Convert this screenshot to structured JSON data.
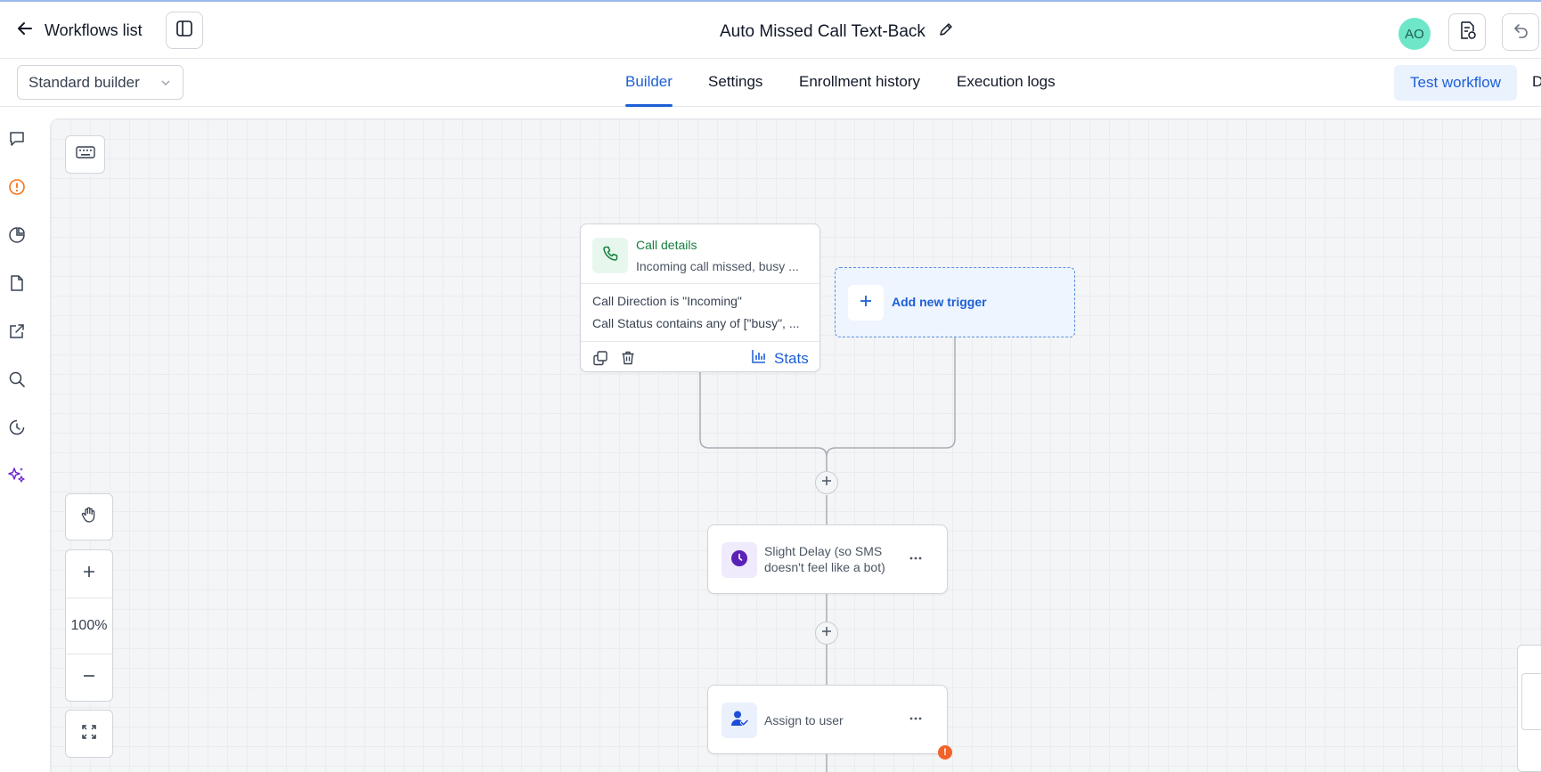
{
  "header": {
    "back_label": "Workflows list",
    "workflow_title": "Auto Missed Call Text-Back",
    "avatar_initials": "AO",
    "avatar_color": "#6ee7c8"
  },
  "subheader": {
    "builder_mode": "Standard builder",
    "tabs": [
      {
        "label": "Builder",
        "active": true
      },
      {
        "label": "Settings",
        "active": false
      },
      {
        "label": "Enrollment history",
        "active": false
      },
      {
        "label": "Execution logs",
        "active": false
      }
    ],
    "test_button": "Test workflow",
    "cut_off_tab": "D"
  },
  "left_rail": {
    "icons": [
      "chat-icon",
      "alert-circle-icon",
      "pie-chart-icon",
      "file-icon",
      "external-link-icon",
      "search-icon",
      "history-icon",
      "sparkle-icon"
    ]
  },
  "canvas": {
    "zoom_level": "100%",
    "trigger": {
      "title": "Call details",
      "subtitle": "Incoming call missed, busy ...",
      "conditions": [
        "Call Direction is \"Incoming\"",
        "Call Status contains any of [\"busy\", ..."
      ],
      "stats_label": "Stats"
    },
    "add_trigger_label": "Add new trigger",
    "actions": [
      {
        "label_line1": "Slight Delay (so SMS",
        "label_line2": "doesn't feel like a bot)",
        "icon": "clock-icon",
        "icon_color": "#5b21b6"
      },
      {
        "label_line1": "Assign to user",
        "icon": "user-assign-icon",
        "icon_color": "#1d4ed8",
        "has_warning": true,
        "warning_glyph": "!"
      }
    ]
  },
  "colors": {
    "accent": "#1d5fd6",
    "trigger_green": "#15803d",
    "warning": "#f0642b"
  }
}
